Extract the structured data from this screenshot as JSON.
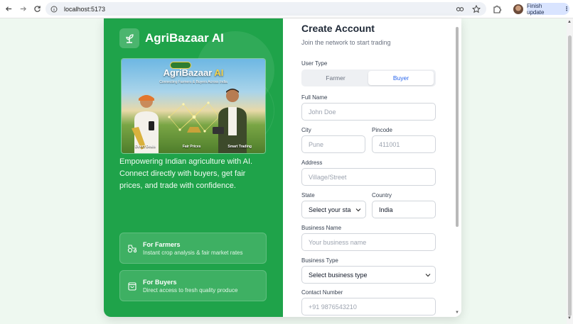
{
  "browser": {
    "url": "localhost:5173",
    "update_label": "Finish update"
  },
  "left_panel": {
    "brand": "AgriBazaar AI",
    "hero": {
      "title_main": "AgriBazaar",
      "title_ai": "AI",
      "subtitle": "Connecting Farmers & Buyers Across India",
      "labels": [
        "Direct Deals",
        "Fair Prices",
        "Smart Trading"
      ]
    },
    "tagline": "Empowering Indian agriculture with AI. Connect directly with buyers, get fair prices, and trade with confidence.",
    "features": [
      {
        "title": "For Farmers",
        "desc": "Instant crop analysis & fair market rates"
      },
      {
        "title": "For Buyers",
        "desc": "Direct access to fresh quality produce"
      }
    ]
  },
  "form": {
    "title": "Create Account",
    "subtitle": "Join the network to start trading",
    "user_type": {
      "label": "User Type",
      "options": [
        "Farmer",
        "Buyer"
      ],
      "selected": "Buyer"
    },
    "full_name": {
      "label": "Full Name",
      "placeholder": "John Doe"
    },
    "city": {
      "label": "City",
      "placeholder": "Pune"
    },
    "pincode": {
      "label": "Pincode",
      "placeholder": "411001"
    },
    "address": {
      "label": "Address",
      "placeholder": "Village/Street"
    },
    "state": {
      "label": "State",
      "value": "Select your sta"
    },
    "country": {
      "label": "Country",
      "value": "India"
    },
    "business_name": {
      "label": "Business Name",
      "placeholder": "Your business name"
    },
    "business_type": {
      "label": "Business Type",
      "value": "Select business type"
    },
    "contact": {
      "label": "Contact Number",
      "placeholder": "+91 9876543210"
    }
  },
  "colors": {
    "brand_green": "#1fa34a",
    "accent_blue": "#2563eb"
  }
}
